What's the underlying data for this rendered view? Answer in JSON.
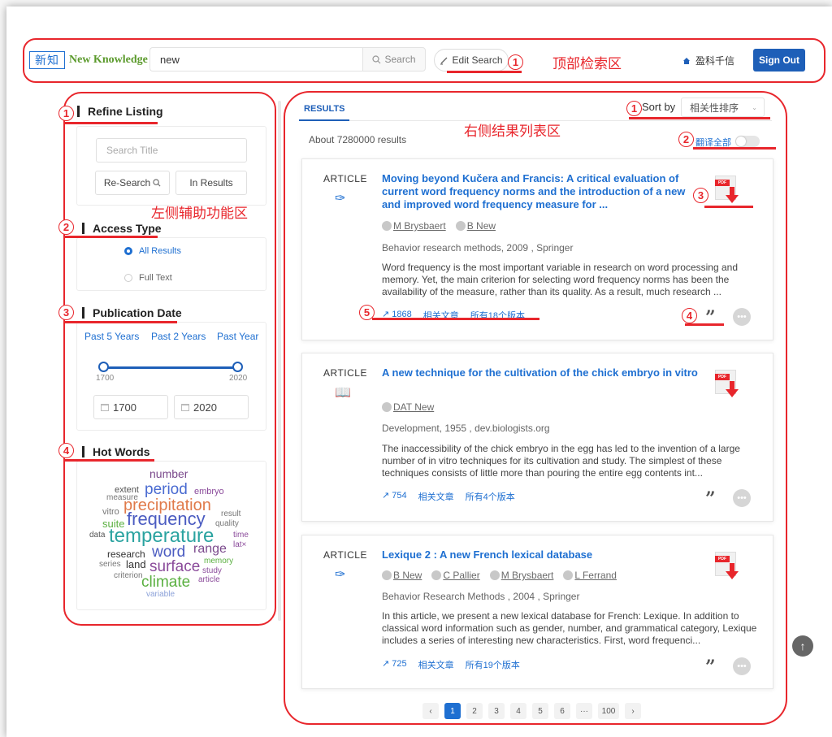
{
  "header": {
    "logo_mark": "新知",
    "logo_text": "New Knowledge",
    "search_value": "new",
    "search_label": "Search",
    "edit_search_label": "Edit Search",
    "org_name": "盈科千信",
    "signout_label": "Sign Out"
  },
  "annotations": {
    "top_area": "顶部检索区",
    "left_area": "左侧辅助功能区",
    "right_area": "右侧结果列表区",
    "n1": "1",
    "n2": "2",
    "n3": "3",
    "n4": "4",
    "n5": "5"
  },
  "sidebar": {
    "refine_title": "Refine Listing",
    "search_title_placeholder": "Search Title",
    "research_label": "Re-Search",
    "in_results_label": "In Results",
    "access_title": "Access Type",
    "access_options": [
      "All Results",
      "Full Text"
    ],
    "pubdate_title": "Publication Date",
    "quick_dates": [
      "Past 5 Years",
      "Past 2 Years",
      "Past Year"
    ],
    "range_min": "1700",
    "range_max": "2020",
    "from_value": "1700",
    "to_value": "2020",
    "hotwords_title": "Hot Words",
    "hotwords": [
      "number",
      "extent",
      "period",
      "embryo",
      "measure",
      "precipitation",
      "vitro",
      "result",
      "frequency",
      "suite",
      "quality",
      "data",
      "temperature",
      "time",
      "lat×",
      "research",
      "word",
      "range",
      "memory",
      "series",
      "land",
      "surface",
      "study",
      "criterion",
      "climate",
      "article",
      "variable"
    ]
  },
  "results": {
    "tab_label": "RESULTS",
    "sort_label": "Sort by",
    "sort_value": "相关性排序",
    "count_text": "About 7280000 results",
    "translate_label": "翻译全部",
    "items": [
      {
        "type": "ARTICLE",
        "title": "Moving beyond Kučera and Francis: A critical evaluation of current word frequency norms and the introduction of a new and improved word frequency measure for ...",
        "authors": [
          "M Brysbaert",
          "B New"
        ],
        "source": "Behavior research methods, 2009 , Springer",
        "abstract": "Word frequency is the most important variable in research on word processing and memory. Yet, the main criterion for selecting word frequency norms has been the availability of the measure, rather than its quality. As a result, much research ...",
        "citations": "1868",
        "related": "相关文章",
        "versions": "所有18个版本",
        "pdf_label": "PDF"
      },
      {
        "type": "ARTICLE",
        "title": "A new technique for the cultivation of the chick embryo in vitro",
        "authors": [
          "DAT New"
        ],
        "source": "Development, 1955 , dev.biologists.org",
        "abstract": "The inaccessibility of the chick embryo in the egg has led to the invention of a large number of in vitro techniques for its cultivation and study. The simplest of these techniques consists of little more than pouring the entire egg contents int...",
        "citations": "754",
        "related": "相关文章",
        "versions": "所有4个版本",
        "pdf_label": "PDF"
      },
      {
        "type": "ARTICLE",
        "title": "Lexique 2 : A new French lexical database",
        "authors": [
          "B New",
          "C Pallier",
          "M Brysbaert",
          "L Ferrand"
        ],
        "source": "Behavior Research Methods , 2004 , Springer",
        "abstract": "In this article, we present a new lexical database for French: Lexique. In addition to classical word information such as gender, number, and grammatical category, Lexique includes a series of interesting new characteristics. First, word frequenci...",
        "citations": "725",
        "related": "相关文章",
        "versions": "所有19个版本",
        "pdf_label": "PDF"
      }
    ]
  },
  "pagination": {
    "pages": [
      "1",
      "2",
      "3",
      "4",
      "5",
      "6",
      "···",
      "100"
    ],
    "current": "1"
  },
  "colors": {
    "accent": "#1e6fd1",
    "annotation": "#e8262c",
    "button": "#1e5fb8"
  }
}
